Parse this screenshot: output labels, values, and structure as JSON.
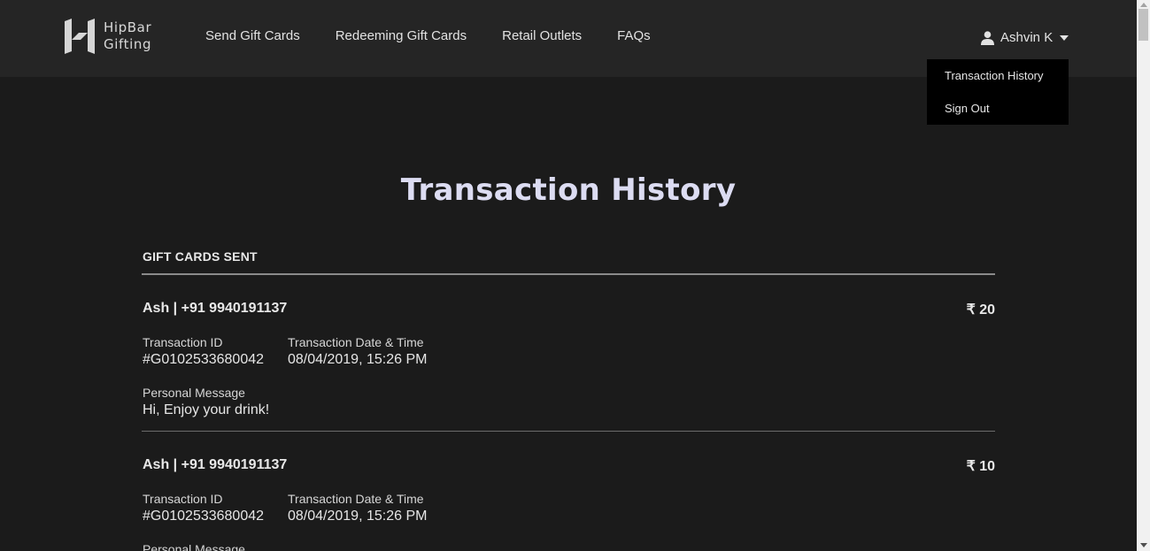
{
  "header": {
    "logo": {
      "line1": "HipBar",
      "line2": "Gifting"
    },
    "nav": [
      {
        "label": "Send Gift Cards"
      },
      {
        "label": "Redeeming Gift Cards"
      },
      {
        "label": "Retail Outlets"
      },
      {
        "label": "FAQs"
      }
    ],
    "user": {
      "name": "Ashvin K",
      "icon": "user-icon"
    },
    "dropdown": [
      {
        "label": "Transaction History"
      },
      {
        "label": "Sign Out"
      }
    ]
  },
  "main": {
    "title": "Transaction History",
    "section_label": "GIFT CARDS SENT",
    "field_labels": {
      "transaction_id": "Transaction ID",
      "date_time": "Transaction Date & Time",
      "message": "Personal Message"
    },
    "transactions": [
      {
        "recipient": "Ash | +91 9940191137",
        "amount": "₹ 20",
        "transaction_id": "#G0102533680042",
        "date_time": "08/04/2019, 15:26 PM",
        "message": "Hi, Enjoy your drink!"
      },
      {
        "recipient": "Ash | +91 9940191137",
        "amount": "₹ 10",
        "transaction_id": "#G0102533680042",
        "date_time": "08/04/2019, 15:26 PM",
        "message": ""
      }
    ]
  },
  "colors": {
    "page_bg": "#1b1b1b",
    "header_bg": "#252525",
    "dropdown_bg": "#000000",
    "title": "#dcdcf2"
  }
}
